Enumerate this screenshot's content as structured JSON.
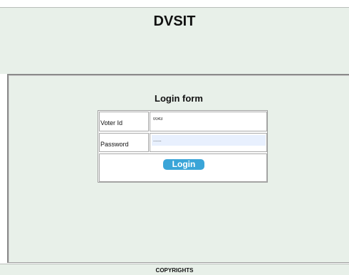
{
  "header": {
    "title": "DVSIT"
  },
  "login_form": {
    "title": "Login form",
    "voter_id": {
      "label": "Voter Id",
      "value": "0043"
    },
    "password": {
      "label": "Password",
      "value": "......"
    },
    "submit_label": "Login"
  },
  "footer": {
    "text": "COPYRIGHTS"
  },
  "colors": {
    "panel_background": "#e8f0e9",
    "button_accent": "#3aa5d8",
    "autofill_background": "#e8f0fe"
  }
}
